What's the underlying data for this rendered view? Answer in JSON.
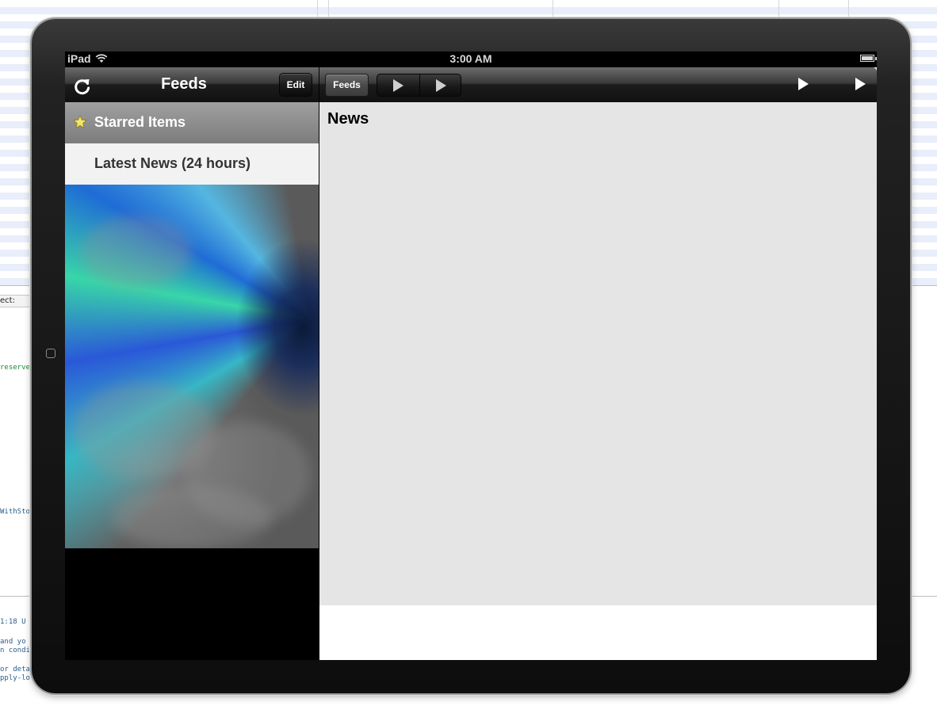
{
  "status_bar": {
    "carrier": "iPad",
    "time": "3:00 AM"
  },
  "master": {
    "title": "Feeds",
    "edit_label": "Edit",
    "items": [
      {
        "label": "Starred Items",
        "icon": "star-icon",
        "selected": true
      },
      {
        "label": "Latest News (24 hours)",
        "icon": "",
        "selected": false
      }
    ]
  },
  "detail": {
    "feeds_button_label": "Feeds",
    "content_title": "News"
  },
  "background": {
    "popup_text": "ect:",
    "code_lines": [
      {
        "text": "reserve",
        "color": "#1a8a3a"
      },
      {
        "text": "WithSto",
        "color": "#2a5e8a"
      },
      {
        "text": "1:18 U",
        "color": "#2a5e8a"
      },
      {
        "text": " and yo",
        "color": "#2a5e8a"
      },
      {
        "text": "n condi",
        "color": "#2a5e8a"
      },
      {
        "text": "or deta",
        "color": "#2a5e8a"
      },
      {
        "text": "pply-lo",
        "color": "#2a5e8a"
      }
    ]
  },
  "colors": {
    "toolbar_dark": "#1c1c1c",
    "content_bg": "#e5e5e5",
    "star_fill": "#f4e468"
  }
}
